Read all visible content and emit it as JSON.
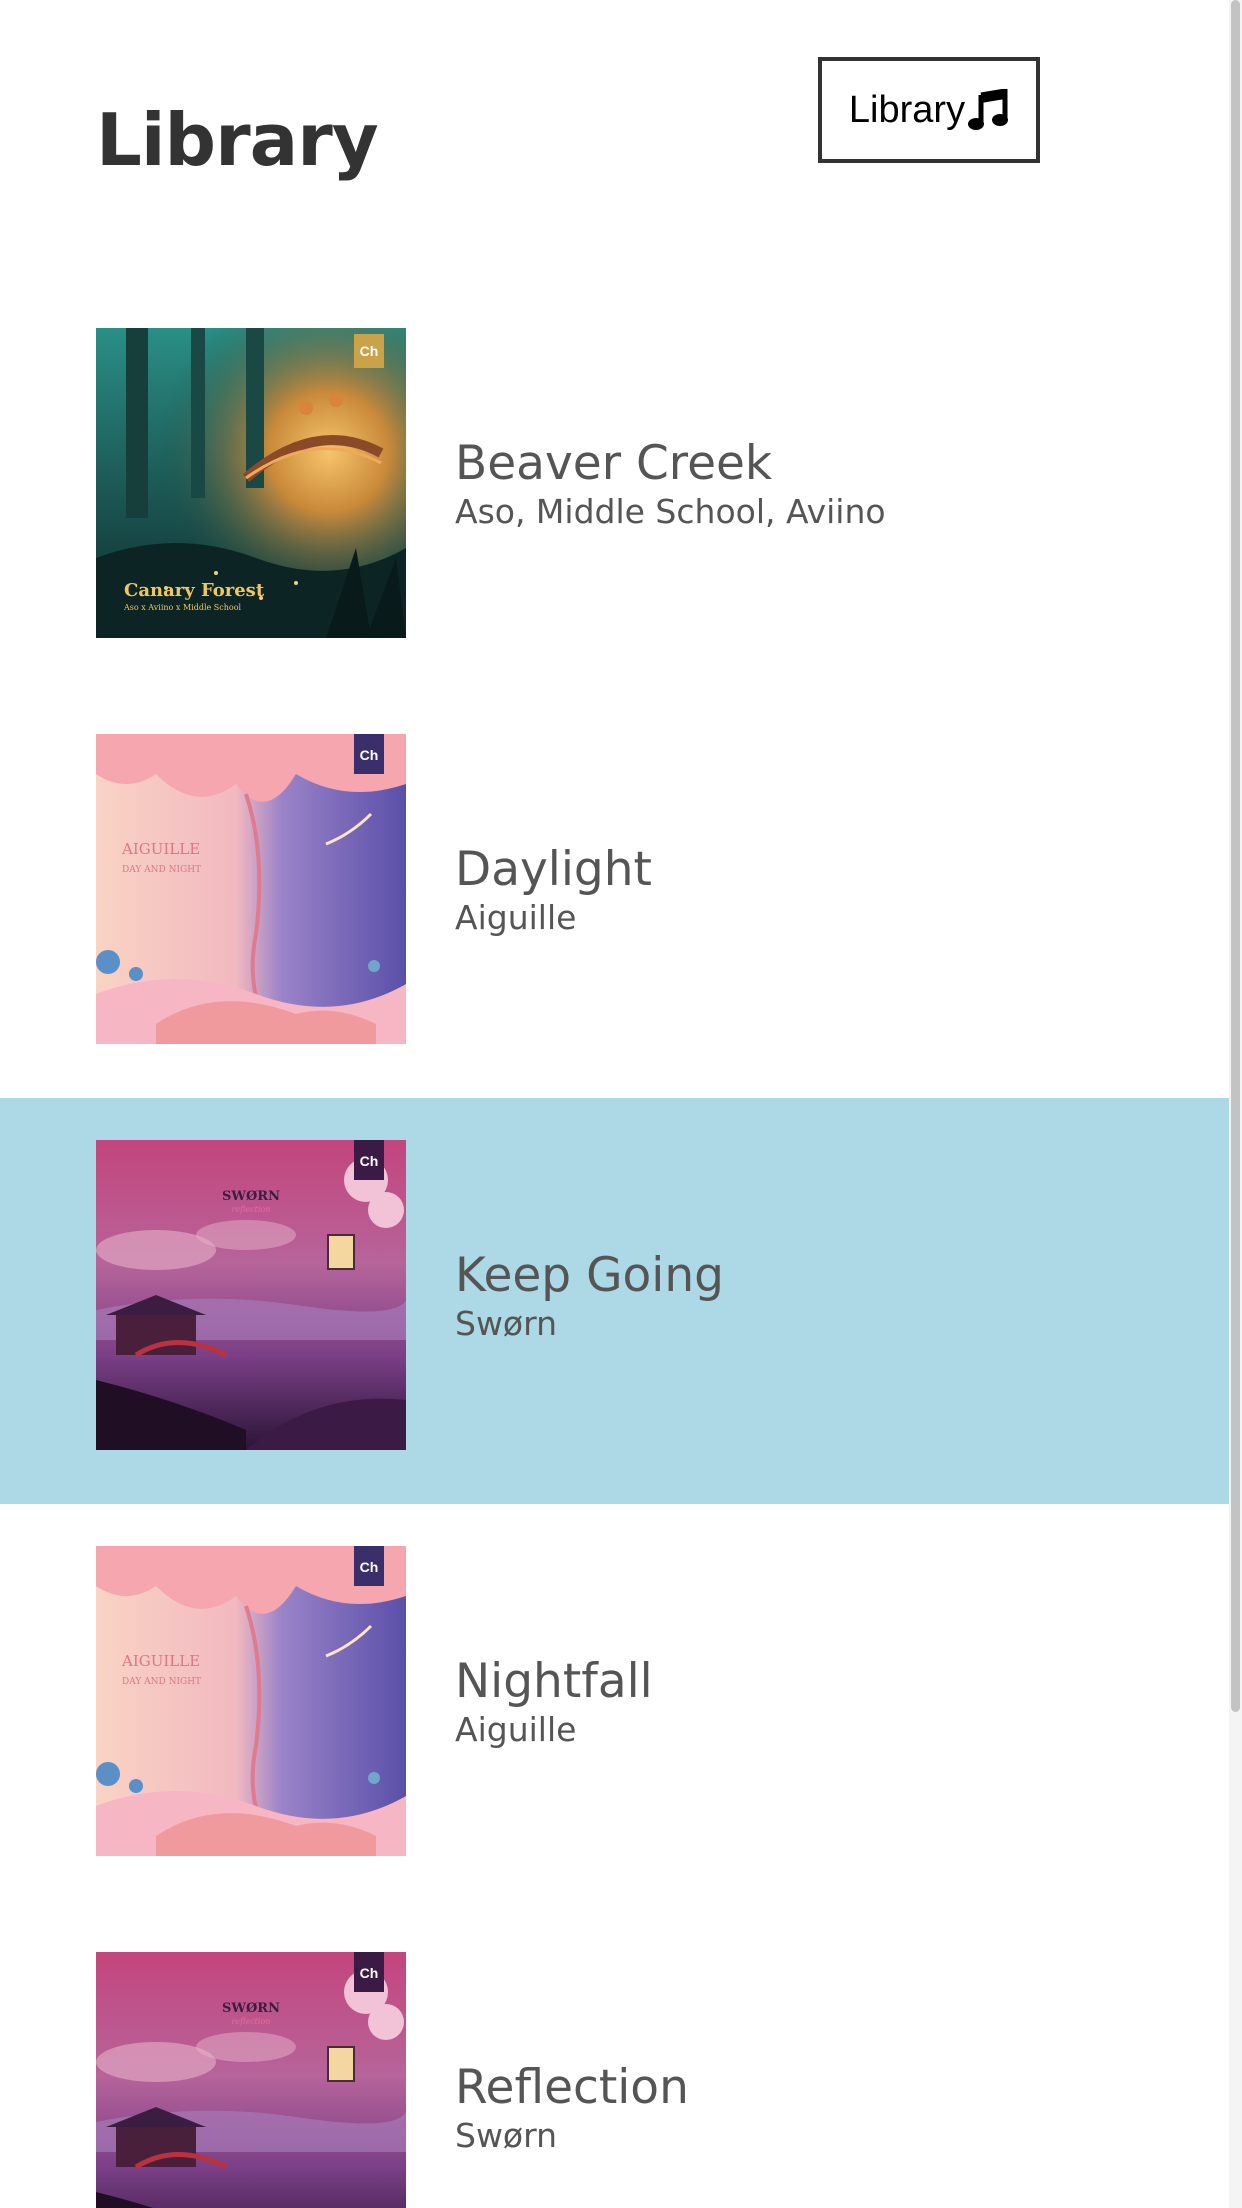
{
  "header": {
    "title": "Library",
    "library_button_label": "Library"
  },
  "tracks": [
    {
      "title": "Beaver Creek",
      "artist": "Aso, Middle School, Aviino",
      "cover_art": "canary-forest",
      "cover_text": "Canary Forest",
      "cover_subtext": "Aso x Aviino x Middle School",
      "selected": false
    },
    {
      "title": "Daylight",
      "artist": "Aiguille",
      "cover_art": "day-and-night",
      "cover_text": "AIGUILLE",
      "cover_subtext": "DAY AND NIGHT",
      "selected": false
    },
    {
      "title": "Keep Going",
      "artist": "Swørn",
      "cover_art": "reflection",
      "cover_text": "SWØRN",
      "cover_subtext": "reflection",
      "selected": true
    },
    {
      "title": "Nightfall",
      "artist": "Aiguille",
      "cover_art": "day-and-night",
      "cover_text": "AIGUILLE",
      "cover_subtext": "DAY AND NIGHT",
      "selected": false
    },
    {
      "title": "Reflection",
      "artist": "Swørn",
      "cover_art": "reflection",
      "cover_text": "SWØRN",
      "cover_subtext": "reflection",
      "selected": false
    }
  ],
  "badge_text": "Ch",
  "colors": {
    "selected_row": "#add8e6",
    "text": "#555555",
    "heading": "#333333"
  },
  "icons": {
    "library_button": "music-note-icon"
  }
}
